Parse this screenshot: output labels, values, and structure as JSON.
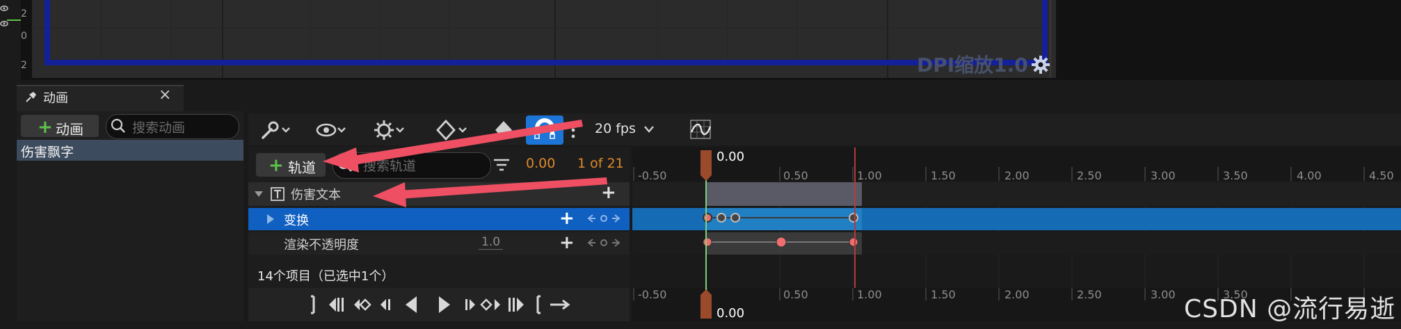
{
  "viewport": {
    "ruler_labels": [
      "2",
      "0",
      "2"
    ],
    "dpi_label": "DPI缩放1.0",
    "dpi_gear_icon": "gear-icon"
  },
  "animation_panel": {
    "tab_title": "动画",
    "tab_icon": "pin-icon",
    "tab_close": "×",
    "add_button_plus": "+",
    "add_button_label": "动画",
    "search_placeholder": "搜索动画",
    "items": [
      "伤害飘字"
    ]
  },
  "toolbar": {
    "icons": [
      "wrench-icon",
      "eye-icon",
      "gear-icon",
      "keyframe-diamond-icon",
      "diamond-icon",
      "magnet-icon",
      "more-vertical-icon",
      "curve-editor-icon"
    ],
    "fps": "20 fps",
    "accent_color": "#1d75d8"
  },
  "tracks": {
    "add_track_plus": "+",
    "add_track_label": "轨道",
    "search_placeholder": "搜索轨道",
    "current_time": "0.00",
    "frame_info": "1 of 21",
    "rows": [
      {
        "label": "伤害文本",
        "plus": "+"
      },
      {
        "label": "变换",
        "plus": "+"
      },
      {
        "label": "渲染不透明度",
        "value": "1.0",
        "plus": "+"
      }
    ],
    "item_count": "14个项目（已选中1个）"
  },
  "timeline": {
    "ticks": [
      "-0.50",
      "0.50",
      "1.00",
      "1.50",
      "2.00",
      "2.50",
      "3.00",
      "3.50",
      "4.00",
      "4.50"
    ],
    "playhead_label": "0.00"
  },
  "watermark": "CSDN @流行易逝"
}
